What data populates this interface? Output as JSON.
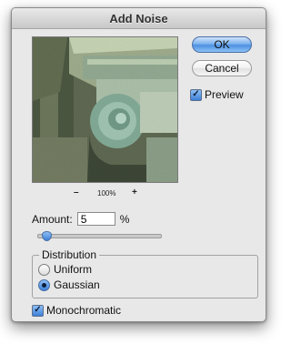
{
  "dialog": {
    "title": "Add Noise"
  },
  "preview": {
    "zoom_out": "–",
    "zoom_level": "100%",
    "zoom_in": "+"
  },
  "buttons": {
    "ok": "OK",
    "cancel": "Cancel"
  },
  "preview_toggle": {
    "label": "Preview",
    "checked": true
  },
  "amount": {
    "label": "Amount:",
    "value": "5",
    "unit": "%",
    "slider_percent": 5
  },
  "distribution": {
    "label": "Distribution",
    "options": [
      {
        "label": "Uniform",
        "selected": false
      },
      {
        "label": "Gaussian",
        "selected": true
      }
    ]
  },
  "monochromatic": {
    "label": "Monochromatic",
    "checked": true
  },
  "colors": {
    "accent": "#3d7fd8",
    "dialog_bg": "#e8e8e8"
  },
  "icons": {
    "check": "checkmark-icon"
  }
}
